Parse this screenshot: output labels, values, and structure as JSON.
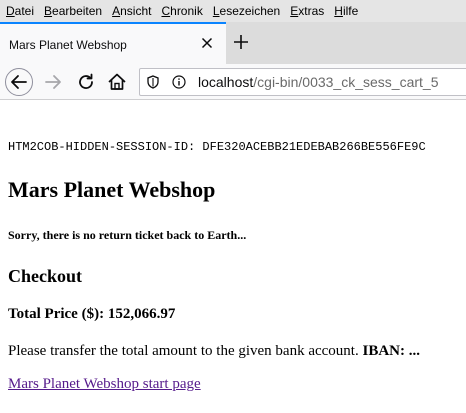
{
  "menubar": {
    "items": [
      {
        "accel": "D",
        "rest": "atei"
      },
      {
        "accel": "B",
        "rest": "earbeiten"
      },
      {
        "accel": "A",
        "rest": "nsicht"
      },
      {
        "accel": "C",
        "rest": "hronik"
      },
      {
        "accel": "L",
        "rest": "esezeichen"
      },
      {
        "accel": "E",
        "rest": "xtras"
      },
      {
        "accel": "H",
        "rest": "ilfe"
      }
    ]
  },
  "tab": {
    "title": "Mars Planet Webshop"
  },
  "urlbar": {
    "host": "localhost",
    "path": "/cgi-bin/0033_ck_sess_cart_5"
  },
  "colors": {
    "accent": "#0a84ff",
    "visited_link": "#551a8b"
  },
  "page": {
    "session_line": "HTM2COB-HIDDEN-SESSION-ID: DFE320ACEBB21EDEBAB266BE556FE9C",
    "title": "Mars Planet Webshop",
    "subtitle": "Sorry, there is no return ticket back to Earth...",
    "checkout_heading": "Checkout",
    "total_label": "Total Price ($): 152,066.97",
    "transfer_text": "Please transfer the total amount to the given bank account. ",
    "iban_label": "IBAN: ...",
    "start_link": "Mars Planet Webshop start page"
  }
}
